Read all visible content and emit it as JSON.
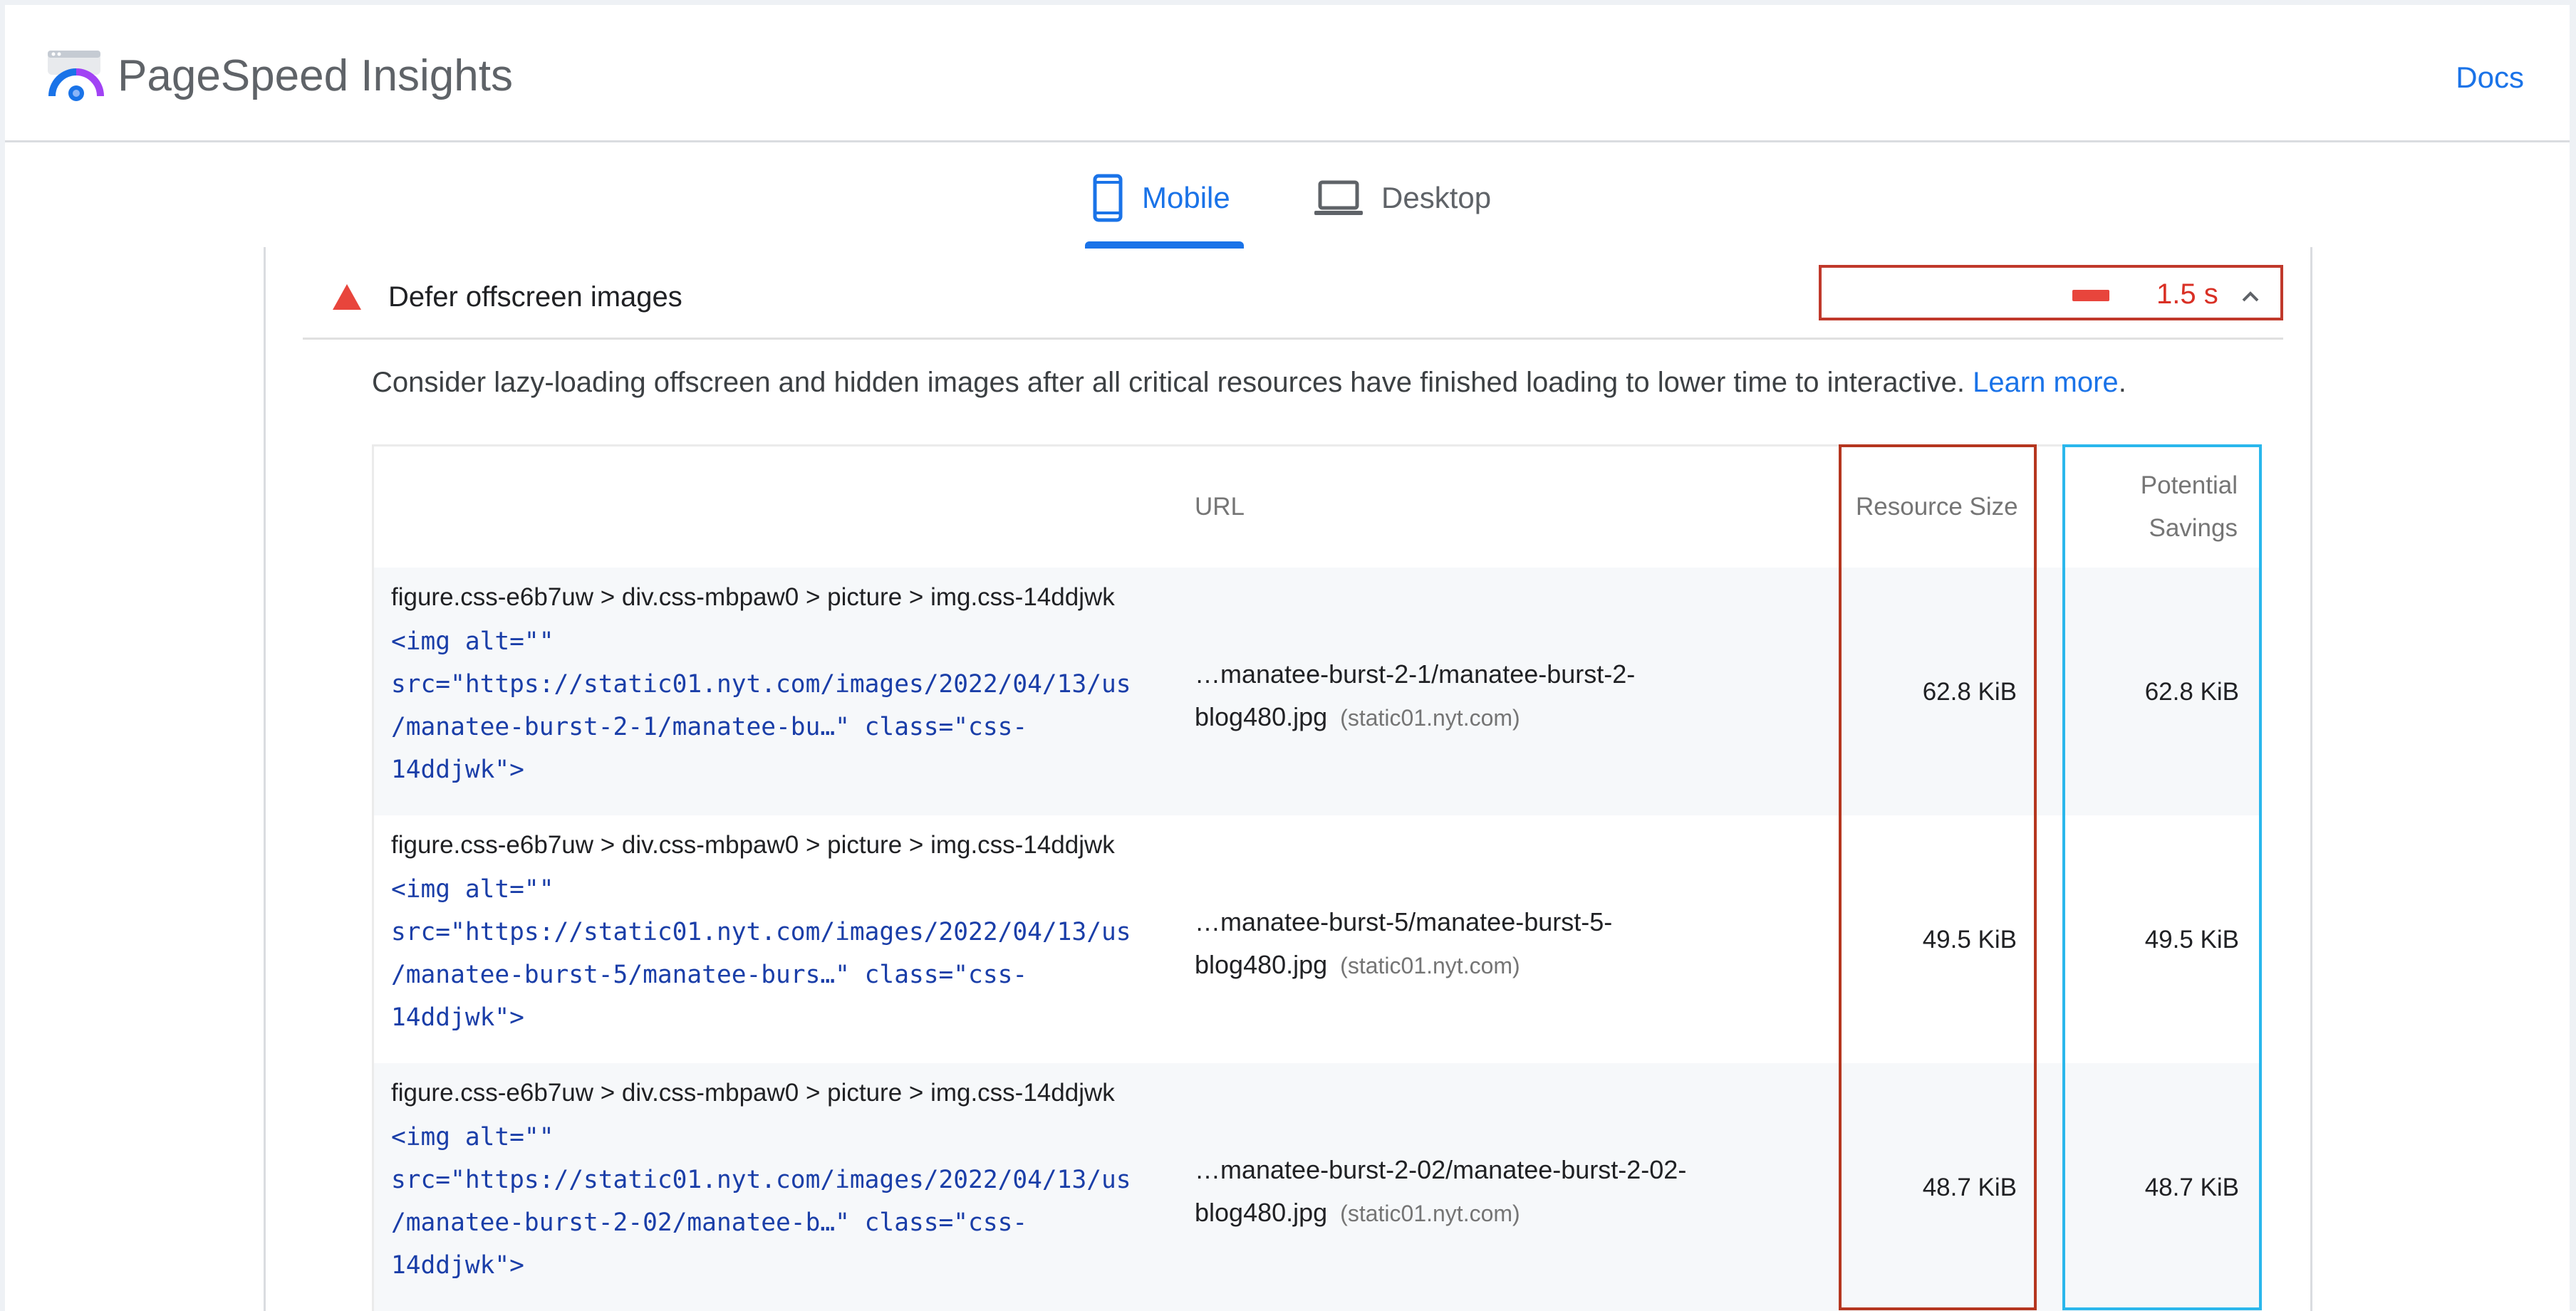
{
  "header": {
    "app_title": "PageSpeed Insights",
    "docs_label": "Docs"
  },
  "tabs": [
    {
      "label": "Mobile",
      "icon": "smartphone-icon",
      "active": true
    },
    {
      "label": "Desktop",
      "icon": "laptop-icon",
      "active": false
    }
  ],
  "audit": {
    "title": "Defer offscreen images",
    "status_icon": "fail-triangle-icon",
    "savings": "1.5 s",
    "expand_icon": "chevron-up-icon",
    "description": "Consider lazy-loading offscreen and hidden images after all critical resources have finished loading to lower time to interactive.",
    "learn_more_label": "Learn more",
    "learn_more_suffix": "."
  },
  "table": {
    "headers": {
      "url": "URL",
      "resource_size": "Resource Size",
      "potential_savings": "Potential Savings"
    },
    "rows": [
      {
        "node_path": "figure.css-e6b7uw > div.css-mbpaw0 > picture > img.css-14ddjwk",
        "snippet": "<img alt=\"\"\nsrc=\"https://static01.nyt.com/images/2022/04/13/us\n/manatee-burst-2-1/manatee-bu…\" class=\"css-\n14ddjwk\">",
        "url_path": "…manatee-burst-2-1/manatee-burst-2-blog480.jpg",
        "url_host": "(static01.nyt.com)",
        "resource_size": "62.8 KiB",
        "potential_savings": "62.8 KiB"
      },
      {
        "node_path": "figure.css-e6b7uw > div.css-mbpaw0 > picture > img.css-14ddjwk",
        "snippet": "<img alt=\"\"\nsrc=\"https://static01.nyt.com/images/2022/04/13/us\n/manatee-burst-5/manatee-burs…\" class=\"css-\n14ddjwk\">",
        "url_path": "…manatee-burst-5/manatee-burst-5-blog480.jpg",
        "url_host": "(static01.nyt.com)",
        "resource_size": "49.5 KiB",
        "potential_savings": "49.5 KiB"
      },
      {
        "node_path": "figure.css-e6b7uw > div.css-mbpaw0 > picture > img.css-14ddjwk",
        "snippet": "<img alt=\"\"\nsrc=\"https://static01.nyt.com/images/2022/04/13/us\n/manatee-burst-2-02/manatee-b…\" class=\"css-\n14ddjwk\">",
        "url_path": "…manatee-burst-2-02/manatee-burst-2-02-blog480.jpg",
        "url_host": "(static01.nyt.com)",
        "resource_size": "48.7 KiB",
        "potential_savings": "48.7 KiB"
      }
    ]
  },
  "colors": {
    "accent": "#1a73e8",
    "fail": "#e8453c",
    "highlight_size": "#b5361f",
    "highlight_savings": "#2ab7ec"
  }
}
